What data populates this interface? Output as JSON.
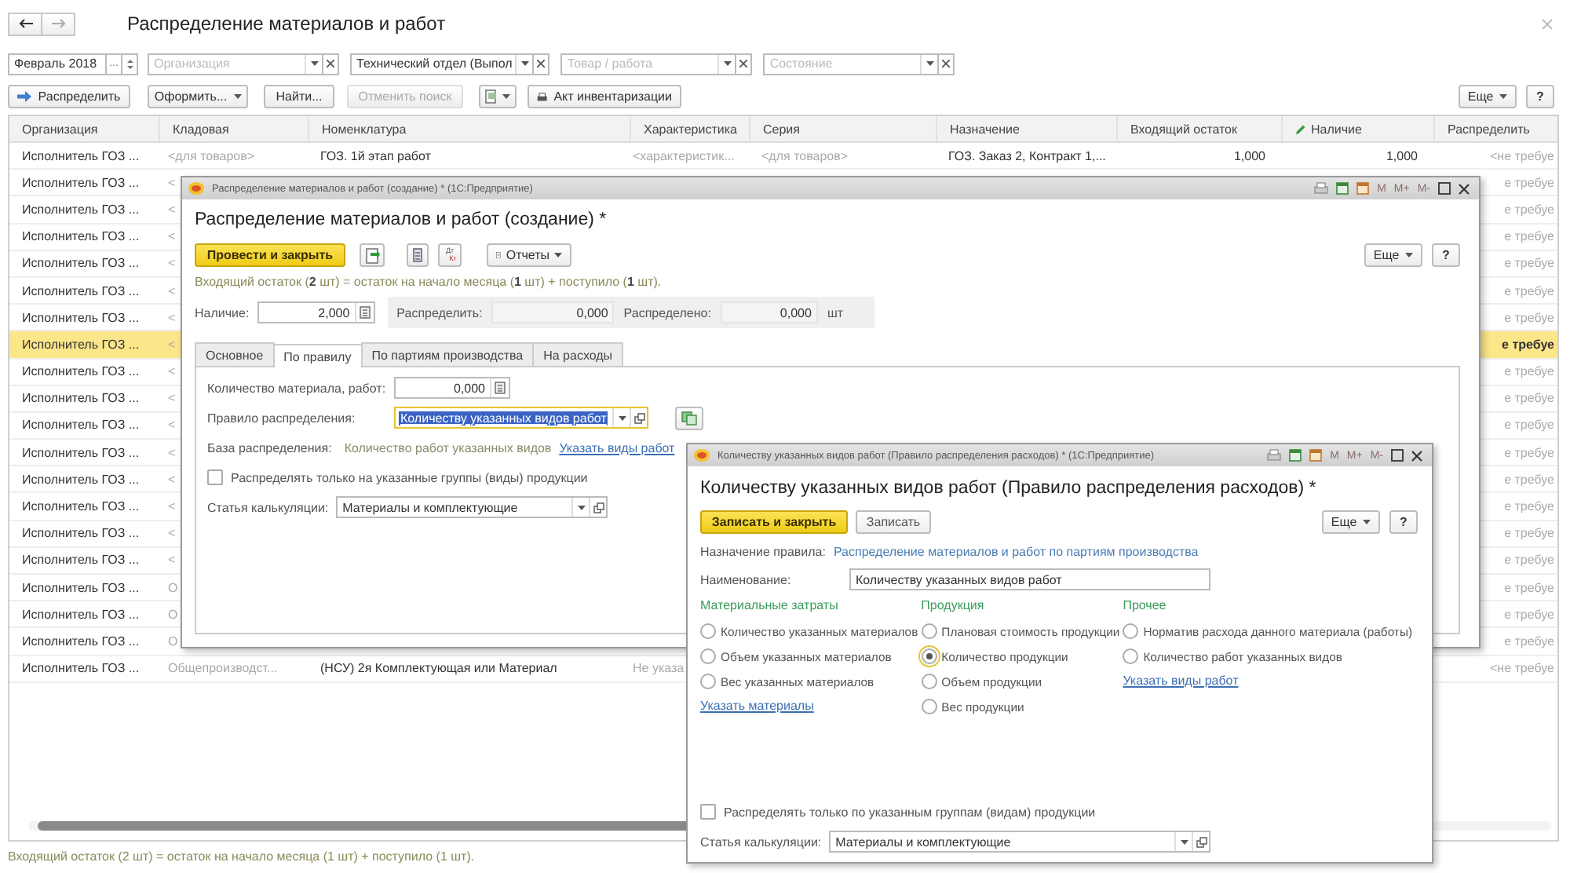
{
  "window": {
    "title": "Распределение материалов и работ"
  },
  "filters": {
    "period": "Февраль 2018",
    "period_button": "...",
    "fields": [
      {
        "placeholder": "Организация"
      },
      {
        "value": "Технический отдел (Выпол"
      },
      {
        "placeholder": "Товар / работа"
      },
      {
        "placeholder": "Состояние"
      }
    ]
  },
  "toolbar": {
    "distribute": "Распределить",
    "format": "Оформить...",
    "find": "Найти...",
    "cancel_search": {
      "label": "Отменить поиск",
      "disabled": true
    },
    "inventory": "Акт инвентаризации",
    "more": "Еще",
    "help": "?"
  },
  "table": {
    "columns": [
      "Организация",
      "Кладовая",
      "Номенклатура",
      "Характеристика",
      "Серия",
      "Назначение",
      "Входящий остаток",
      "Наличие",
      "Распределить"
    ],
    "rows": [
      {
        "selected": false,
        "cells": [
          "Исполнитель ГОЗ ...",
          "<для товаров>",
          "ГОЗ. 1й этап работ",
          "<характеристик...",
          "<для товаров>",
          "ГОЗ. Заказ 2, Контракт 1,...",
          "1,000",
          "1,000",
          "<не требуе"
        ]
      },
      {
        "selected": false,
        "cells": [
          "Исполнитель ГОЗ ...",
          "<",
          null,
          null,
          null,
          null,
          null,
          null,
          "е требуе"
        ]
      },
      {
        "selected": false,
        "cells": [
          "Исполнитель ГОЗ ...",
          "<",
          null,
          null,
          null,
          null,
          null,
          null,
          "е требуе"
        ]
      },
      {
        "selected": false,
        "cells": [
          "Исполнитель ГОЗ ...",
          "<",
          null,
          null,
          null,
          null,
          null,
          null,
          "е требуе"
        ]
      },
      {
        "selected": false,
        "cells": [
          "Исполнитель ГОЗ ...",
          "<",
          null,
          null,
          null,
          null,
          null,
          null,
          "е требуе"
        ]
      },
      {
        "selected": false,
        "cells": [
          "Исполнитель ГОЗ ...",
          "<",
          null,
          null,
          null,
          null,
          null,
          null,
          "е требуе"
        ]
      },
      {
        "selected": false,
        "cells": [
          "Исполнитель ГОЗ ...",
          "<",
          null,
          null,
          null,
          null,
          null,
          null,
          "е требуе"
        ]
      },
      {
        "selected": true,
        "cells": [
          "Исполнитель ГОЗ ...",
          "<",
          null,
          null,
          null,
          null,
          null,
          null,
          "е требуе"
        ]
      },
      {
        "selected": false,
        "cells": [
          "Исполнитель ГОЗ ...",
          "<",
          null,
          null,
          null,
          null,
          null,
          null,
          "е требуе"
        ]
      },
      {
        "selected": false,
        "cells": [
          "Исполнитель ГОЗ ...",
          "<",
          null,
          null,
          null,
          null,
          null,
          null,
          "е требуе"
        ]
      },
      {
        "selected": false,
        "cells": [
          "Исполнитель ГОЗ ...",
          "<",
          null,
          null,
          null,
          null,
          null,
          null,
          "е требуе"
        ]
      },
      {
        "selected": false,
        "cells": [
          "Исполнитель ГОЗ ...",
          "<",
          null,
          null,
          null,
          null,
          null,
          null,
          "е требуе"
        ]
      },
      {
        "selected": false,
        "cells": [
          "Исполнитель ГОЗ ...",
          "<",
          null,
          null,
          null,
          null,
          null,
          null,
          "е требуе"
        ]
      },
      {
        "selected": false,
        "cells": [
          "Исполнитель ГОЗ ...",
          "<",
          null,
          null,
          null,
          null,
          null,
          null,
          "е требуе"
        ]
      },
      {
        "selected": false,
        "cells": [
          "Исполнитель ГОЗ ...",
          "<",
          null,
          null,
          null,
          null,
          null,
          null,
          "е требуе"
        ]
      },
      {
        "selected": false,
        "cells": [
          "Исполнитель ГОЗ ...",
          "<",
          null,
          null,
          null,
          null,
          null,
          null,
          "е требуе"
        ]
      },
      {
        "selected": false,
        "cells": [
          "Исполнитель ГОЗ ...",
          "О",
          null,
          null,
          null,
          null,
          null,
          null,
          "е требуе"
        ]
      },
      {
        "selected": false,
        "cells": [
          "Исполнитель ГОЗ ...",
          "О",
          null,
          null,
          null,
          null,
          null,
          null,
          "е требуе"
        ]
      },
      {
        "selected": false,
        "cells": [
          "Исполнитель ГОЗ ...",
          "О",
          null,
          null,
          null,
          null,
          null,
          null,
          "е требуе"
        ]
      },
      {
        "selected": false,
        "cells": [
          "Исполнитель ГОЗ ...",
          "Общепроизводст...",
          "(НСУ) 2я Комплектующая или Материал",
          "Не указа",
          null,
          null,
          null,
          null,
          "<не требуе"
        ]
      }
    ]
  },
  "status": "Входящий остаток (2 шт) = остаток на начало месяца (1 шт) + поступило (1 шт).",
  "document_form": {
    "title_bar": "Распределение материалов и работ (создание) * (1С:Предприятие)",
    "title_bar_buttons": [
      "M",
      "M+",
      "M-"
    ],
    "heading": "Распределение материалов и работ (создание) *",
    "post_close": "Провести и закрыть",
    "dt_kt": [
      "Дт",
      "Кт"
    ],
    "reports": "Отчеты",
    "more": "Еще",
    "help": "?",
    "balance_note": "Входящий остаток (**2** шт) = остаток на начало месяца (**1** шт) + поступило (**1** шт).",
    "available": {
      "label": "Наличие:",
      "value": "2,000"
    },
    "to_distribute": {
      "label": "Распределить:",
      "value": "0,000"
    },
    "distributed": {
      "label": "Распределено:",
      "value": "0,000"
    },
    "unit": "шт",
    "tabs": [
      {
        "label": "Основное",
        "selected": false
      },
      {
        "label": "По правилу",
        "selected": true
      },
      {
        "label": "По партиям производства",
        "selected": false
      },
      {
        "label": "На расходы",
        "selected": false
      }
    ],
    "quantity": {
      "label": "Количество материала, работ:",
      "value": "0,000"
    },
    "rule": {
      "label": "Правило распределения:",
      "value": "Количеству указанных видов работ"
    },
    "base": {
      "label": "База распределения:",
      "value": "Количество работ указанных видов",
      "link": "Указать виды работ"
    },
    "only_groups": {
      "label": "Распределять только на указанные группы (виды) продукции",
      "checked": false
    },
    "cost_item": {
      "label": "Статья калькуляции:",
      "value": "Материалы и комплектующие"
    }
  },
  "rule_form": {
    "title_bar": "Количеству указанных видов работ (Правило распределения расходов) * (1С:Предприятие)",
    "title_bar_buttons": [
      "M",
      "M+",
      "M-"
    ],
    "heading": "Количеству указанных видов работ (Правило распределения расходов) *",
    "save_close": "Записать и закрыть",
    "save": "Записать",
    "more": "Еще",
    "help": "?",
    "purpose": {
      "label": "Назначение правила:",
      "value": "Распределение материалов и работ по партиям производства"
    },
    "name": {
      "label": "Наименование:",
      "value": "Количеству указанных видов работ"
    },
    "groups": [
      {
        "title": "Материальные затраты",
        "options": [
          {
            "label": "Количество указанных материалов",
            "selected": false
          },
          {
            "label": "Объем указанных материалов",
            "selected": false
          },
          {
            "label": "Вес указанных материалов",
            "selected": false
          }
        ],
        "link": "Указать материалы"
      },
      {
        "title": "Продукция",
        "options": [
          {
            "label": "Плановая стоимость продукции",
            "selected": false
          },
          {
            "label": "Количество продукции",
            "selected": true
          },
          {
            "label": "Объем продукции",
            "selected": false
          },
          {
            "label": "Вес продукции",
            "selected": false
          }
        ]
      },
      {
        "title": "Прочее",
        "options": [
          {
            "label": "Норматив расхода данного материала (работы)",
            "selected": false
          },
          {
            "label": "Количество работ указанных видов",
            "selected": false
          }
        ],
        "link": "Указать виды работ"
      }
    ],
    "only_groups": {
      "label": "Распределять только по указанным группам (видам) продукции",
      "checked": false
    },
    "cost_item": {
      "label": "Статья калькуляции:",
      "value": "Материалы и комплектующие"
    }
  }
}
